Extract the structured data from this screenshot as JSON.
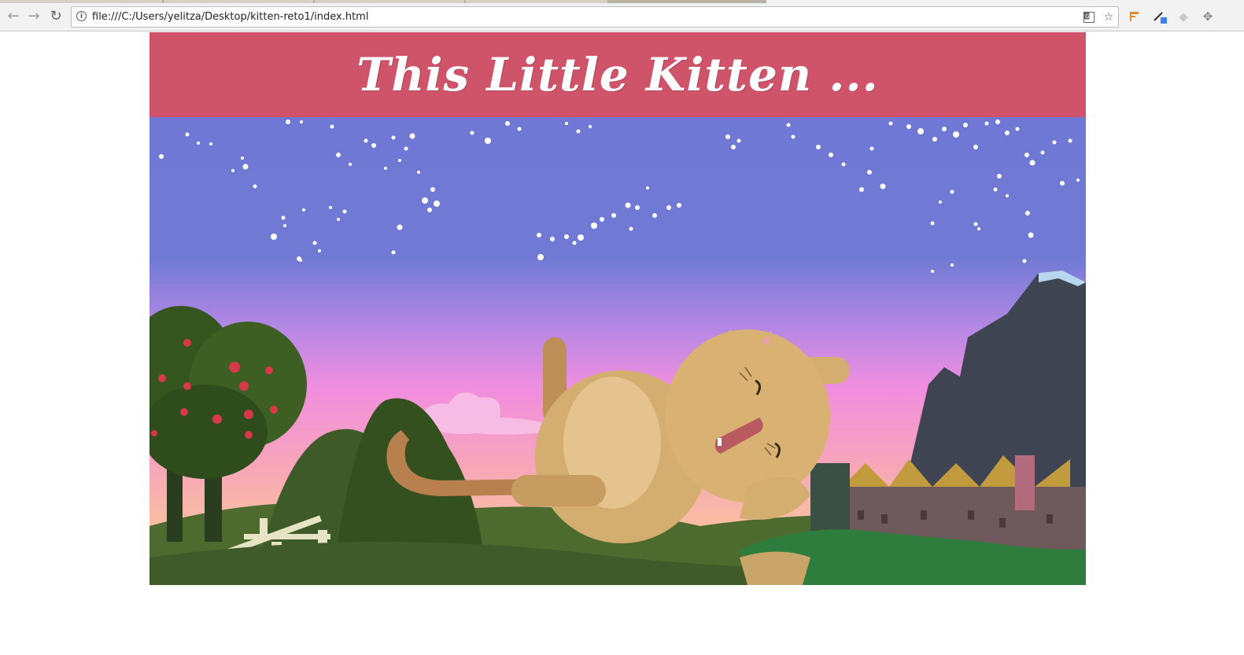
{
  "browser": {
    "url": "file:///C:/Users/yelitza/Desktop/kitten-reto1/index.html",
    "icons": [
      "back-arrow-icon",
      "forward-arrow-icon",
      "reload-icon",
      "info-icon",
      "translate-icon",
      "star-icon",
      "extension-flag-icon",
      "eyedropper-icon",
      "extension-diamond-icon",
      "move-cross-icon"
    ]
  },
  "page": {
    "title": "This Little Kitten ...",
    "header_color": "#d05469"
  },
  "hero": {
    "image": "illustration-kitten-lying-on-hill-at-dusk",
    "sky_top": "#6f78d4",
    "sky_bottom": "#f28edf"
  }
}
